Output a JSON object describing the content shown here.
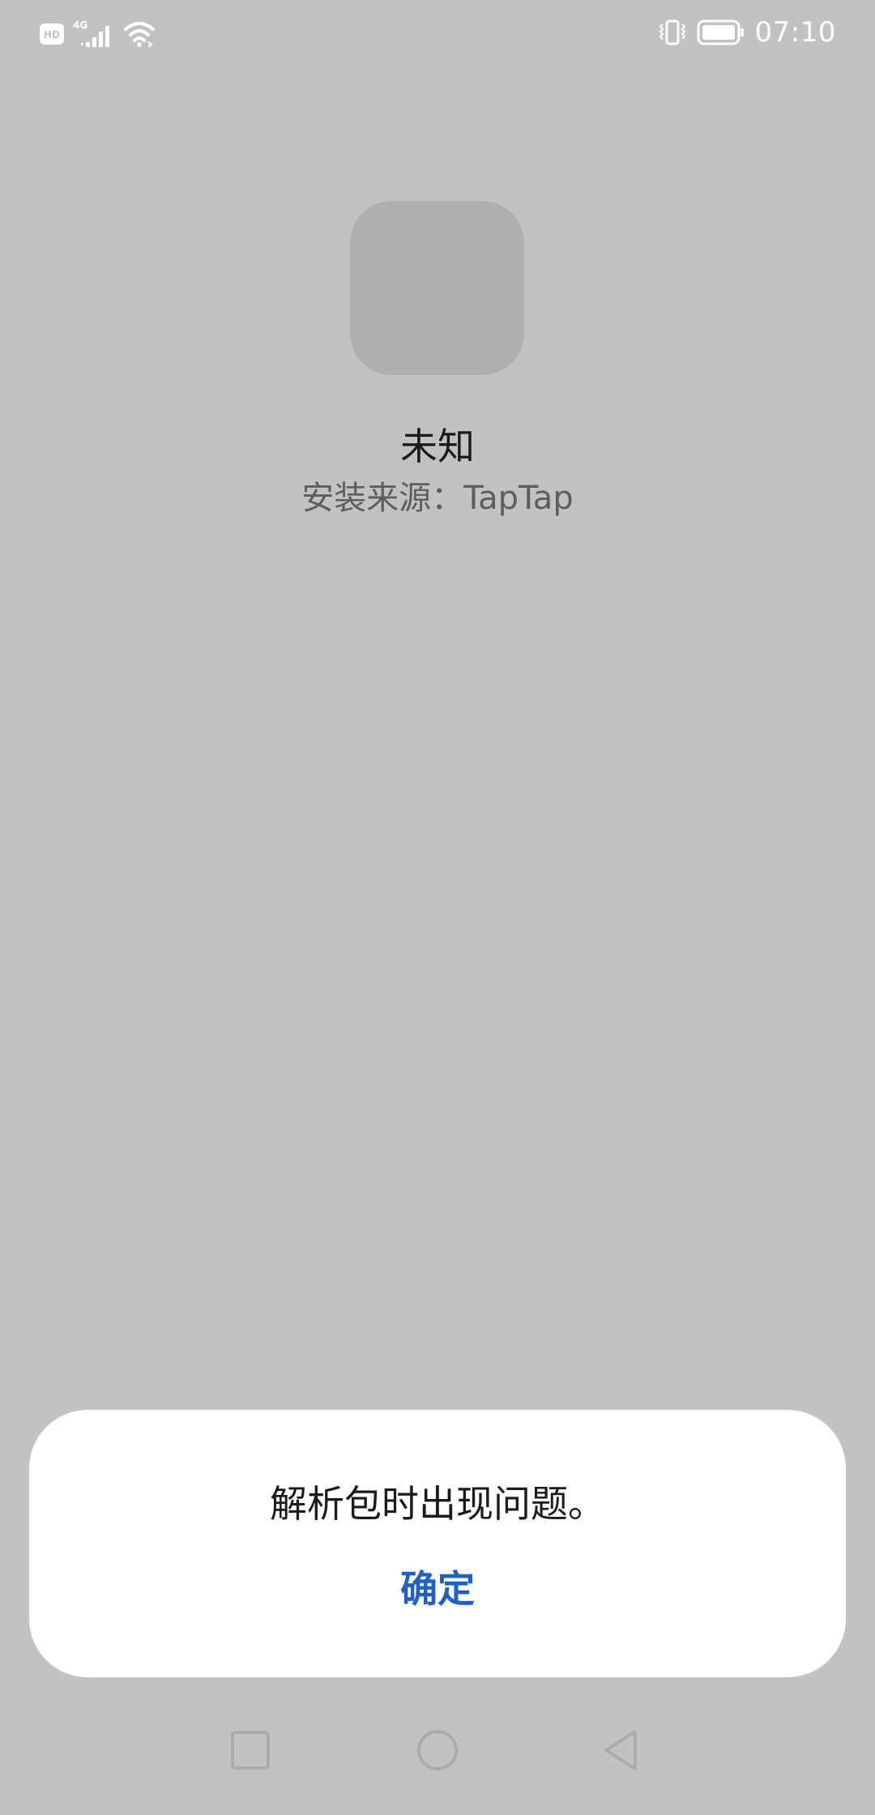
{
  "status_bar": {
    "network_badge": "HD",
    "network_type": "4G",
    "time": "07:10",
    "icons": [
      "hd-icon",
      "cellular-signal-icon",
      "wifi-icon",
      "vibrate-icon",
      "battery-icon"
    ]
  },
  "app": {
    "icon": "app-placeholder-icon",
    "name": "未知",
    "source": "安装来源：TapTap"
  },
  "dialog": {
    "message": "解析包时出现问题。",
    "confirm_label": "确定"
  },
  "nav_bar": {
    "icons": [
      "recents-square-icon",
      "home-circle-icon",
      "back-triangle-icon"
    ]
  },
  "colors": {
    "background": "#c1c2c4",
    "icon_placeholder": "#aeafb1",
    "dialog_background": "#ffffff",
    "accent": "#1f5fcc"
  }
}
